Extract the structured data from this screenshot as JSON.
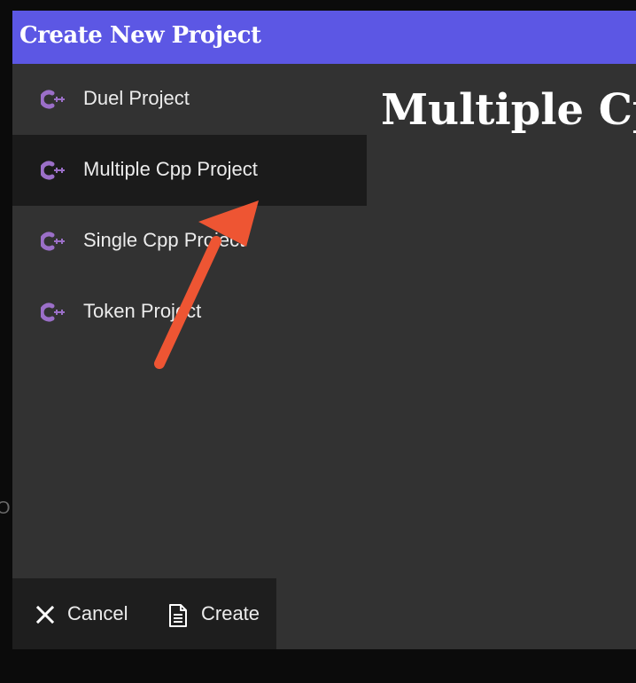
{
  "background": {
    "partial_text": "O"
  },
  "dialog": {
    "title": "Create New Project",
    "preview_title": "Multiple Cpp",
    "selected_index": 1,
    "accent_color": "#5c57e4",
    "icon_color": "#9b6fc8",
    "project_types": [
      {
        "label": "Duel Project",
        "icon": "cpp-icon"
      },
      {
        "label": "Multiple Cpp Project",
        "icon": "cpp-icon"
      },
      {
        "label": "Single Cpp Project",
        "icon": "cpp-icon"
      },
      {
        "label": "Token Project",
        "icon": "cpp-icon"
      }
    ],
    "footer": {
      "cancel_label": "Cancel",
      "cancel_icon": "close-icon",
      "create_label": "Create",
      "create_icon": "document-icon"
    }
  },
  "annotation": {
    "arrow_color": "#ee5533",
    "arrow_icon": "pointer-arrow"
  }
}
